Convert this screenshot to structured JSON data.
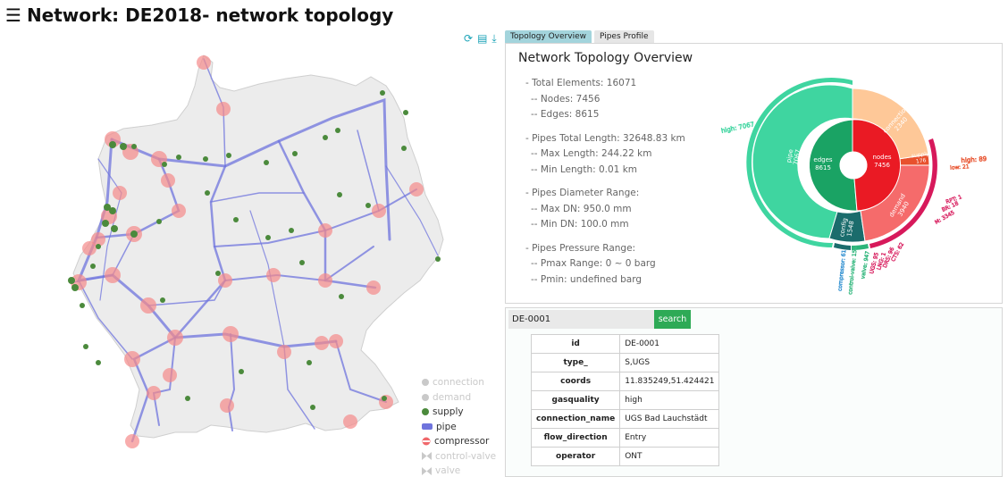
{
  "header": {
    "menu_icon": "hamburger-icon",
    "title": "Network: DE2018- network topology"
  },
  "toolbar": {
    "icons": [
      "refresh-icon",
      "document-icon",
      "download-icon"
    ]
  },
  "tabs": [
    {
      "label": "Topology Overview",
      "active": true
    },
    {
      "label": "Pipes Profile",
      "active": false
    }
  ],
  "overview": {
    "title": "Network Topology Overview",
    "lines": {
      "total": "- Total Elements: 16071",
      "nodes": "-- Nodes: 7456",
      "edges": "-- Edges: 8615",
      "len": "- Pipes Total Length: 32648.83 km",
      "maxlen": "-- Max Length: 244.22 km",
      "minlen": "-- Min Length: 0.01 km",
      "dia": "- Pipes Diameter Range:",
      "maxdn": "-- Max DN: 950.0 mm",
      "mindn": "-- Min DN: 100.0 mm",
      "pres": "- Pipes Pressure Range:",
      "pmax": "-- Pmax Range: 0 ~ 0 barg",
      "pmin": "-- Pmin: undefined barg"
    }
  },
  "sunburst": {
    "center": [
      {
        "name": "edges",
        "value": "8615",
        "color": "#1aa364"
      },
      {
        "name": "nodes",
        "value": "7456",
        "color": "#ea1a24"
      }
    ],
    "outer": [
      {
        "name": "pipe",
        "value": "7067",
        "color": "#3fd5a0"
      },
      {
        "name": "config",
        "value": "1548",
        "color": "#1b6c6c"
      },
      {
        "name": "demand",
        "value": "3940",
        "color": "#f56b6b"
      },
      {
        "name": "connection",
        "value": "2340",
        "color": "#fec898"
      },
      {
        "name": "supply",
        "value": "176",
        "color": "#e8512d"
      }
    ],
    "side_labels": [
      "high: 7067",
      "compressor: 61",
      "control-valve: 158",
      "valve: 947",
      "UGS: 95",
      "LNG: 1",
      "DRS: 96",
      "CTS: 62",
      "M: 3345",
      "BR: 18",
      "RPT: 1",
      "high: 89",
      "low: 21"
    ]
  },
  "search": {
    "value": "DE-0001",
    "button": "search"
  },
  "details": [
    {
      "key": "id",
      "value": "DE-0001"
    },
    {
      "key": "type_",
      "value": "S,UGS"
    },
    {
      "key": "coords",
      "value": "11.835249,51.424421"
    },
    {
      "key": "gasquality",
      "value": "high"
    },
    {
      "key": "connection_name",
      "value": "UGS Bad Lauchstädt"
    },
    {
      "key": "flow_direction",
      "value": "Entry"
    },
    {
      "key": "operator",
      "value": "ONT"
    }
  ],
  "legend": [
    {
      "label": "connection",
      "active": false,
      "icon": "circle",
      "color": "#c9c9c9"
    },
    {
      "label": "demand",
      "active": false,
      "icon": "circle",
      "color": "#c9c9c9"
    },
    {
      "label": "supply",
      "active": true,
      "icon": "circle",
      "color": "#4b8a3c"
    },
    {
      "label": "pipe",
      "active": true,
      "icon": "bar",
      "color": "#6f74dd"
    },
    {
      "label": "compressor",
      "active": true,
      "icon": "compressor",
      "color": "#f0686b"
    },
    {
      "label": "control-valve",
      "active": false,
      "icon": "bowtie",
      "color": "#c9c9c9"
    },
    {
      "label": "valve",
      "active": false,
      "icon": "bowtie",
      "color": "#c9c9c9"
    }
  ]
}
